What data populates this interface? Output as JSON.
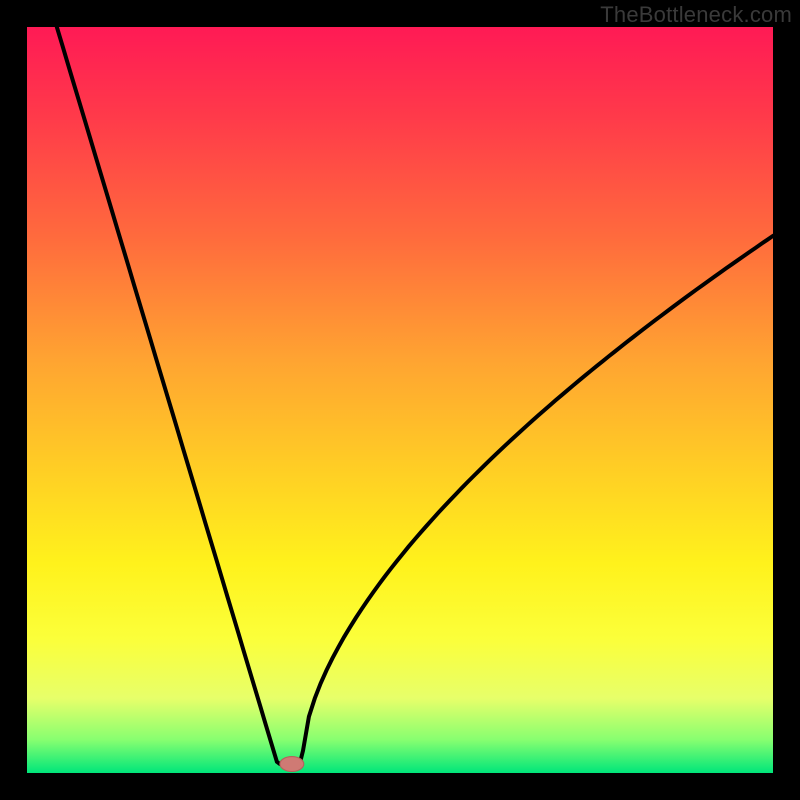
{
  "watermark": "TheBottleneck.com",
  "colors": {
    "frame": "#000000",
    "curve": "#000000",
    "marker_fill": "#cf7a74",
    "marker_stroke": "#b6605c",
    "gradient_stops": [
      {
        "offset": 0,
        "color": "#ff1a55"
      },
      {
        "offset": 0.12,
        "color": "#ff3a4a"
      },
      {
        "offset": 0.28,
        "color": "#ff6a3d"
      },
      {
        "offset": 0.45,
        "color": "#ffa531"
      },
      {
        "offset": 0.6,
        "color": "#ffd024"
      },
      {
        "offset": 0.72,
        "color": "#fff21c"
      },
      {
        "offset": 0.82,
        "color": "#fbff3a"
      },
      {
        "offset": 0.9,
        "color": "#e7ff6a"
      },
      {
        "offset": 0.955,
        "color": "#88ff70"
      },
      {
        "offset": 1.0,
        "color": "#00e67a"
      }
    ]
  },
  "chart_data": {
    "type": "line",
    "title": "",
    "xlabel": "",
    "ylabel": "",
    "xlim": [
      0,
      100
    ],
    "ylim": [
      0,
      100
    ],
    "grid": false,
    "legend": false,
    "left_branch": {
      "x_start": 4,
      "x_end": 33.5,
      "y_start": 100,
      "y_end": 1.5
    },
    "vertex": {
      "x": 35,
      "y": 1.0
    },
    "right_branch": {
      "x_start": 37,
      "y_at_start": 3,
      "x_end": 100,
      "y_at_end": 72,
      "curvature": 0.62
    },
    "marker": {
      "x": 35.5,
      "y": 1.2,
      "rx": 1.6,
      "ry": 1.0
    },
    "series": [
      {
        "name": "curve",
        "note": "V-shaped bottleneck curve; minimum near x≈35"
      }
    ]
  }
}
